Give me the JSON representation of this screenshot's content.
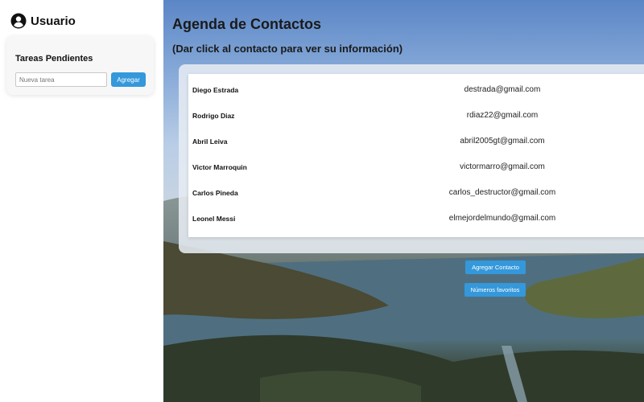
{
  "sidebar": {
    "user_label": "Usuario",
    "tasks": {
      "title": "Tareas Pendientes",
      "input_placeholder": "Nueva tarea",
      "add_label": "Agregar"
    }
  },
  "main": {
    "title": "Agenda de Contactos",
    "subtitle": "(Dar click al contacto para ver su información)",
    "contacts": [
      {
        "name": "Diego Estrada",
        "email": "destrada@gmail.com"
      },
      {
        "name": "Rodrigo Diaz",
        "email": "rdiaz22@gmail.com"
      },
      {
        "name": "Abril Leiva",
        "email": "abril2005gt@gmail.com"
      },
      {
        "name": "Victor Marroquin",
        "email": "victormarro@gmail.com"
      },
      {
        "name": "Carlos Pineda",
        "email": "carlos_destructor@gmail.com"
      },
      {
        "name": "Leonel Messi",
        "email": "elmejordelmundo@gmail.com"
      }
    ],
    "add_contact_label": "Agregar Contacto",
    "favorites_label": "Números favoritos"
  },
  "colors": {
    "accent": "#3498db",
    "sidebar_bg": "#ffffff",
    "card_bg": "#f7f7f7"
  },
  "icons": {
    "user": "user-circle-icon"
  }
}
